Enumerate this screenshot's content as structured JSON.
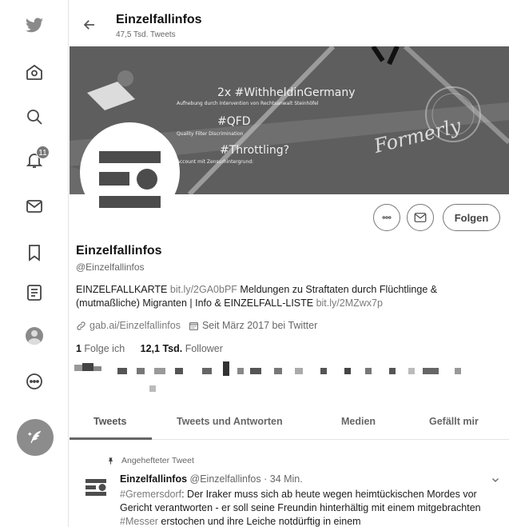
{
  "nav": {
    "notifications_badge": "11"
  },
  "header": {
    "title": "Einzelfallinfos",
    "tweet_count": "47,5 Tsd. Tweets"
  },
  "banner": {
    "line1": "2x #WithheldinGermany",
    "line1_sub": "Aufhebung durch Intervention von Rechtsanwalt Steinhöfel",
    "line2": "#QFD",
    "line2_sub": "Quality Filter Discrimination",
    "line3": "#Throttling?",
    "line3_sub": "Account mit Zensurhintergrund:",
    "stamp": "Formerly"
  },
  "profile": {
    "follow_label": "Folgen",
    "name": "Einzelfallinfos",
    "handle": "@Einzelfallinfos",
    "bio_part1": "EINZELFALLKARTE ",
    "bio_link1": "bit.ly/2GA0bPF",
    "bio_part2": " Meldungen zu Straftaten durch Flüchtlinge & (mutmaßliche) Migranten | Info & EINZELFALL-LISTE ",
    "bio_link2": "bit.ly/2MZwx7p",
    "website": "gab.ai/Einzelfallinfos",
    "joined": "Seit März 2017 bei Twitter",
    "following_count": "1",
    "following_label": " Folge ich",
    "followers_count": "12,1 Tsd.",
    "followers_label": " Follower"
  },
  "tabs": [
    "Tweets",
    "Tweets und Antworten",
    "Medien",
    "Gefällt mir"
  ],
  "tweet": {
    "pinned_label": "Angehefteter Tweet",
    "author": "Einzelfallinfos",
    "handle_time": " @Einzelfallinfos · 34 Min.",
    "hashtag1": "#Gremersdorf",
    "text1": ": Der Iraker muss sich ab heute wegen heimtückischen Mordes vor Gericht verantworten - er soll seine Freundin hinterhältig mit einem mitgebrachten ",
    "hashtag2": "#Messer",
    "text2": " erstochen und ihre Leiche notdürftig in einem"
  }
}
